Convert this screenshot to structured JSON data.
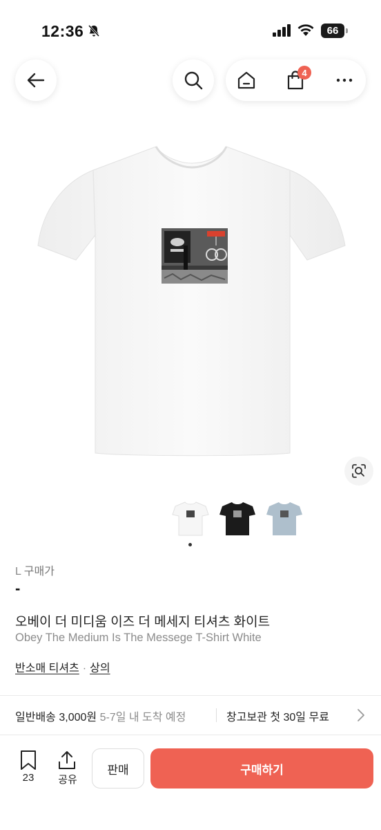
{
  "status_bar": {
    "time": "12:36",
    "battery": "66"
  },
  "header": {
    "cart_count": "4"
  },
  "product": {
    "price_label_size": "L",
    "price_label": "구매가",
    "price_value": "-",
    "title_ko": "오베이 더 미디움 이즈 더 메세지 티셔츠 화이트",
    "title_en": "Obey The Medium Is The Messege T-Shirt White",
    "category_1": "반소매 티셔츠",
    "category_sep": "·",
    "category_2": "상의",
    "thumbnails": [
      "white",
      "black",
      "light-blue"
    ]
  },
  "delivery": {
    "shipping_label": "일반배송",
    "shipping_fee": "3,000원",
    "shipping_eta": "5-7일 내 도착 예정",
    "warehouse_label": "창고보관",
    "warehouse_note": "첫 30일 무료"
  },
  "bottom_bar": {
    "wish_count": "23",
    "share_label": "공유",
    "sell_label": "판매",
    "buy_label": "구매하기"
  },
  "colors": {
    "accent": "#ef6253",
    "text": "#222222",
    "muted": "#8b8b8b"
  }
}
